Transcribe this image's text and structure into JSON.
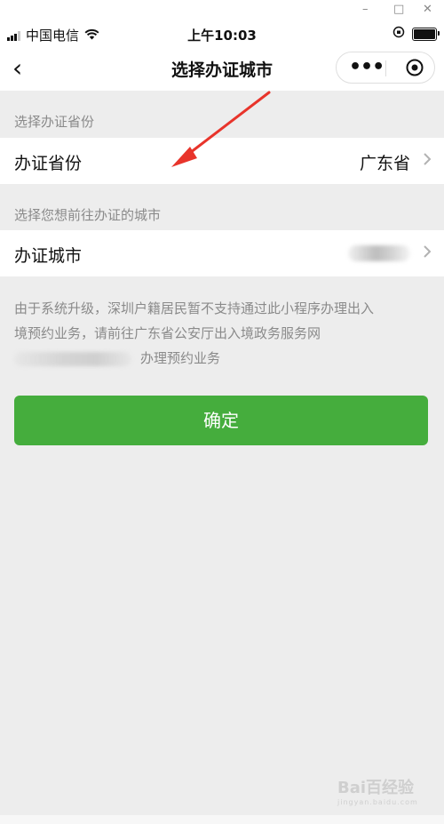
{
  "window": {
    "minimize": "–",
    "maximize": "□",
    "close": "✕"
  },
  "status_bar": {
    "carrier": "中国电信",
    "time": "上午10:03"
  },
  "nav": {
    "title": "选择办证城市",
    "back_icon": "‹",
    "more_icon": "•••"
  },
  "province_section": {
    "label": "选择办证省份",
    "row_label": "办证省份",
    "value": "广东省"
  },
  "city_section": {
    "label": "选择您想前往办证的城市",
    "row_label": "办证城市"
  },
  "notice": {
    "line1": "由于系统升级，深圳户籍居民暂不支持通过此小程序办理出入",
    "line2": "境预约业务，请前往广东省公安厅出入境政务服务网",
    "line3": "办理预约业务"
  },
  "confirm_label": "确定",
  "watermark": {
    "brand": "Bai百经验",
    "sub": "jingyan.baidu.com"
  },
  "colors": {
    "primary_button": "#45ad3d",
    "annotation_arrow": "#e8342b",
    "background": "#ededed"
  }
}
